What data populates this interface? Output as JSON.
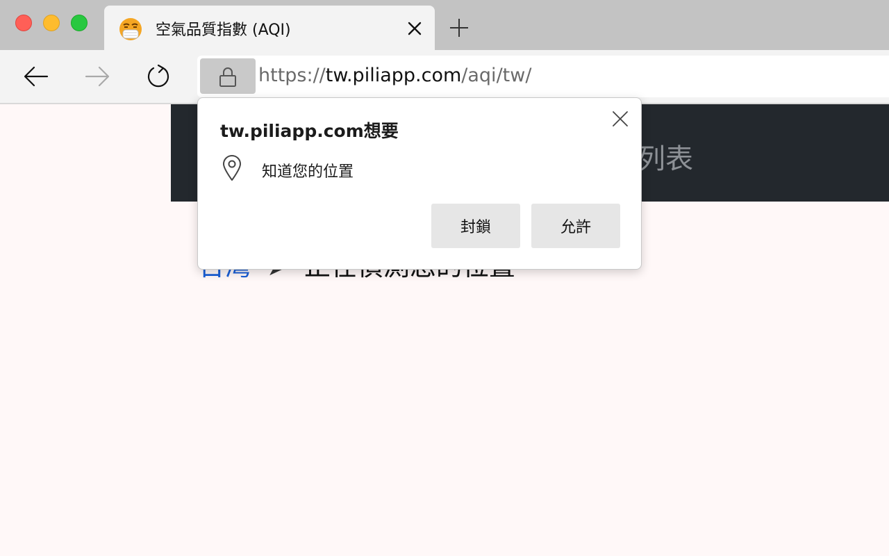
{
  "browser": {
    "tab": {
      "title": "空氣品質指數 (AQI)",
      "favicon": "face-with-medical-mask-emoji"
    },
    "address_bar": {
      "url_scheme": "https://",
      "url_host": "tw.piliapp.com",
      "url_path": "/aqi/tw/"
    },
    "colors": {
      "tabstrip": "#c3c3c3",
      "toolbar": "#f3f3f3"
    }
  },
  "page": {
    "header_text": "列表",
    "breadcrumb": {
      "link": "台灣",
      "separator": "➤",
      "current": "正在偵測您的位置"
    },
    "colors": {
      "background": "#fff8f8",
      "header": "#23282d",
      "link": "#1a5fd6"
    }
  },
  "permission_popup": {
    "title": "tw.piliapp.com想要",
    "message": "知道您的位置",
    "block_label": "封鎖",
    "allow_label": "允許",
    "icons": [
      "close-icon",
      "location-pin-icon"
    ]
  }
}
